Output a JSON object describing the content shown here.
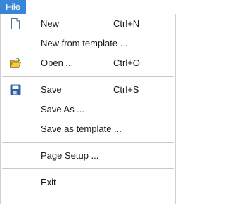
{
  "menubar": {
    "file_label": "File"
  },
  "menu": {
    "items": [
      {
        "label": "New",
        "shortcut": "Ctrl+N",
        "icon": "new-document-icon"
      },
      {
        "label": "New from template ...",
        "shortcut": "",
        "icon": ""
      },
      {
        "label": "Open ...",
        "shortcut": "Ctrl+O",
        "icon": "open-folder-icon"
      },
      {
        "label": "Save",
        "shortcut": "Ctrl+S",
        "icon": "save-disk-icon"
      },
      {
        "label": "Save As ...",
        "shortcut": "",
        "icon": ""
      },
      {
        "label": "Save as template ...",
        "shortcut": "",
        "icon": ""
      },
      {
        "label": "Page Setup ...",
        "shortcut": "",
        "icon": ""
      },
      {
        "label": "Exit",
        "shortcut": "",
        "icon": ""
      }
    ]
  },
  "colors": {
    "menubar_active_bg": "#3a86d6",
    "menubar_active_text": "#ffffff",
    "separator": "#c9c9c9"
  }
}
